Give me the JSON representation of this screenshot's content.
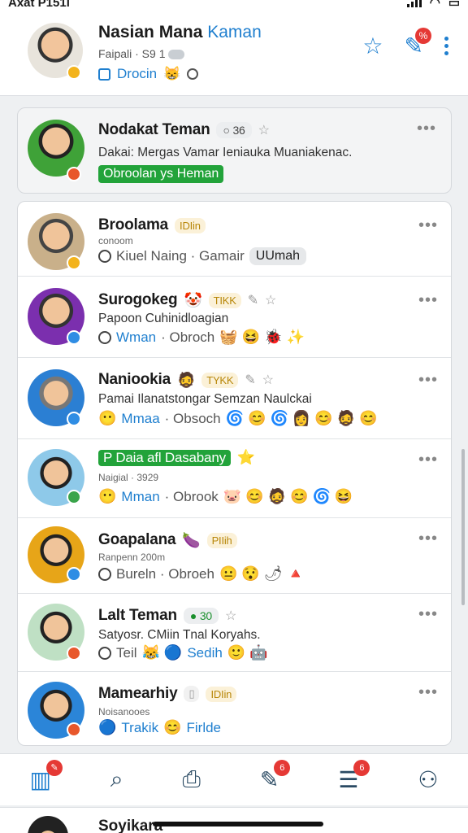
{
  "status_bar": {
    "left": "Axat P151i"
  },
  "header": {
    "name": "Nasian Mana",
    "name_accent": "Kaman",
    "subtitle": "Faipali · S9 1",
    "row3_text": "Drocin"
  },
  "featured": {
    "title": "Nodakat Teman",
    "count": "36",
    "description": "Dakai: Mergas Vamar Ieniauka Muaniakenac.",
    "action": "Obroolan ys Heman"
  },
  "rows": [
    {
      "title": "Broolama",
      "tag": "IDIin",
      "sub": "conoom",
      "line3": "Kiuel Naing · Gamair",
      "pill": "UUmah"
    },
    {
      "title": "Surogokeg",
      "tag": "TIKK",
      "sub": "Papoon Cuhinidloagian",
      "line3_blue": "Wman",
      "line3": "· Obroch"
    },
    {
      "title": "Naniookia",
      "tag": "TYKK",
      "sub": "Pamai Ilanatstongar Semzan Naulckai",
      "line3_blue": "Mmaa",
      "line3": "· Obsoch"
    },
    {
      "title": "P Daia afl Dasabany",
      "sub": "Naigial · 3929",
      "line3_blue": "Mman",
      "line3": "· Obrook"
    },
    {
      "title": "Goapalana",
      "tag": "PIIih",
      "sub": "Ranpenn 200m",
      "line3": "Bureln · Obroeh"
    },
    {
      "title": "Lalt Teman",
      "count": "30",
      "sub": "Satyosr. CMiin Tnal Koryahs.",
      "line3_a": "Teil",
      "line3_blue": "Sedih"
    },
    {
      "title": "Mamearhiy",
      "tag": "IDIin",
      "sub": "Noisanooes",
      "line3_blue": "Trakik",
      "line3_b": "Firlde"
    }
  ],
  "peek": {
    "title": "Soyikara"
  },
  "tabbar": {
    "badges": [
      "",
      "",
      "",
      "6",
      "6",
      ""
    ]
  }
}
